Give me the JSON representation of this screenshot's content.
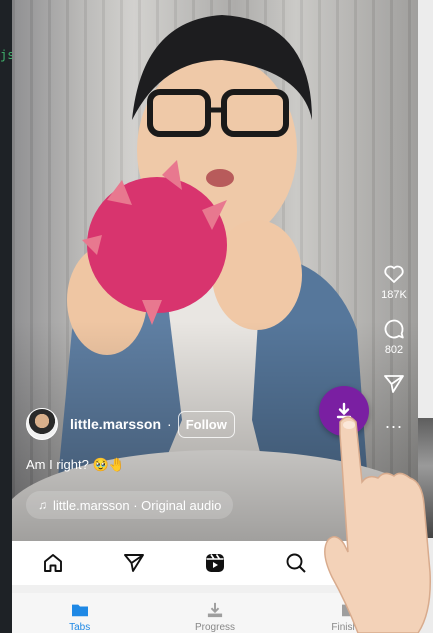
{
  "editor": {
    "snippet": "js"
  },
  "reel": {
    "actions": {
      "like_count": "187K",
      "comment_count": "802",
      "more": "..."
    },
    "author": {
      "username": "little.marsson",
      "separator": "·",
      "follow_label": "Follow"
    },
    "caption": "Am I right? 🥹🤚",
    "audio": {
      "note_icon": "♫",
      "text": "little.marsson · Original audio"
    }
  },
  "ig_nav": {
    "icons": [
      "home-icon",
      "send-icon",
      "reels-icon",
      "search-icon",
      "profile-icon"
    ]
  },
  "app_tabs": [
    {
      "label": "Tabs",
      "icon": "folder-icon",
      "active": true
    },
    {
      "label": "Progress",
      "icon": "download-icon",
      "active": false
    },
    {
      "label": "Finished",
      "icon": "folder-icon",
      "active": false
    }
  ],
  "colors": {
    "fab": "#7a1fa2",
    "active_tab": "#1e88e5",
    "inactive_tab": "#9e9e9e"
  }
}
